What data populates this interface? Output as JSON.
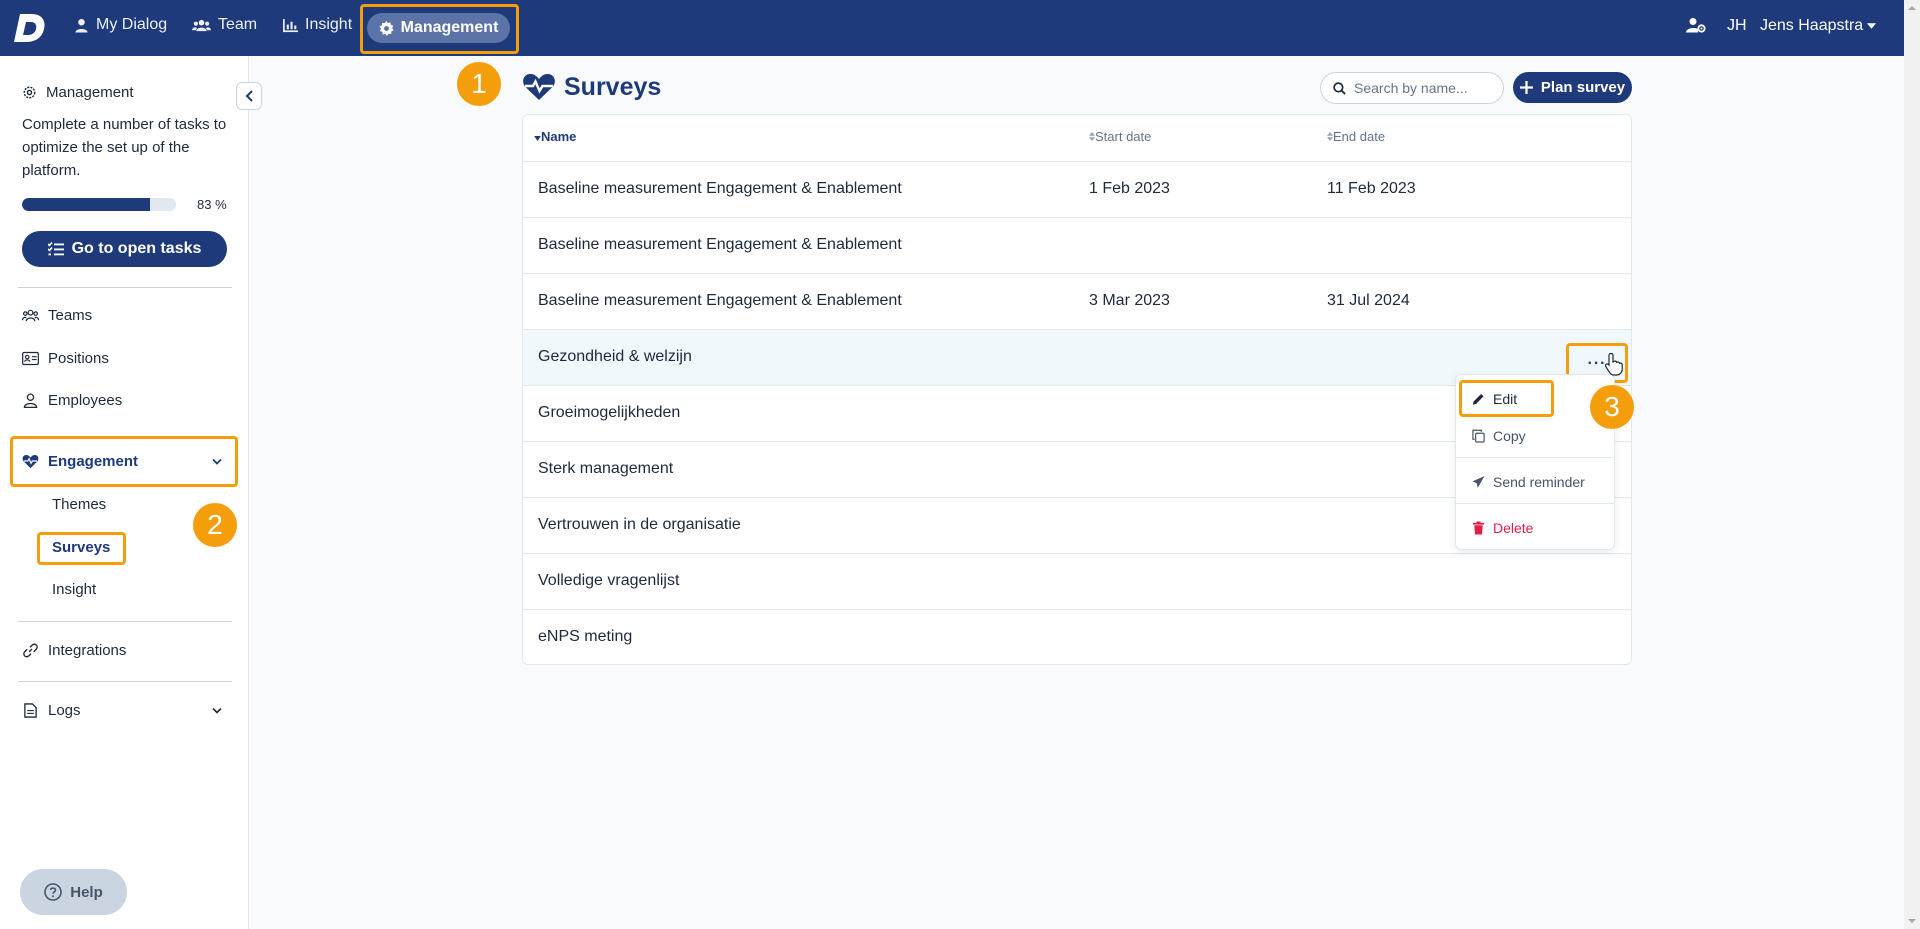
{
  "nav": {
    "items": [
      {
        "label": "My Dialog"
      },
      {
        "label": "Team"
      },
      {
        "label": "Insight"
      }
    ],
    "active_label": "Management",
    "user_initials": "JH",
    "user_name": "Jens Haapstra",
    "logo_letter": "D"
  },
  "annotations": {
    "step1": "1",
    "step2": "2",
    "step3": "3"
  },
  "sidebar": {
    "title": "Management",
    "description": "Complete a number of tasks to optimize the set up of the platform.",
    "progress_percent": 83,
    "progress_label": "83 %",
    "tasks_button": "Go to open tasks",
    "items": {
      "teams": "Teams",
      "positions": "Positions",
      "employees": "Employees",
      "engagement": "Engagement",
      "themes": "Themes",
      "surveys": "Surveys",
      "insight": "Insight",
      "integrations": "Integrations",
      "logs": "Logs"
    },
    "help": "Help"
  },
  "main": {
    "title": "Surveys",
    "search_placeholder": "Search by name...",
    "plan_button": "Plan survey",
    "columns": {
      "name": "Name",
      "start": "Start date",
      "end": "End date"
    },
    "rows": [
      {
        "name": "Baseline measurement Engagement & Enablement",
        "start": "1 Feb 2023",
        "end": "11 Feb 2023"
      },
      {
        "name": "Baseline measurement Engagement & Enablement",
        "start": "",
        "end": ""
      },
      {
        "name": "Baseline measurement Engagement & Enablement",
        "start": "3 Mar 2023",
        "end": "31 Jul 2024"
      },
      {
        "name": "Gezondheid & welzijn",
        "start": "",
        "end": ""
      },
      {
        "name": "Groeimogelijkheden",
        "start": "",
        "end": ""
      },
      {
        "name": "Sterk management",
        "start": "",
        "end": ""
      },
      {
        "name": "Vertrouwen in de organisatie",
        "start": "",
        "end": ""
      },
      {
        "name": "Volledige vragenlijst",
        "start": "",
        "end": ""
      },
      {
        "name": "eNPS meting",
        "start": "",
        "end": ""
      }
    ],
    "row_actions": "···",
    "menu": {
      "edit": "Edit",
      "copy": "Copy",
      "reminder": "Send reminder",
      "delete": "Delete"
    }
  },
  "colors": {
    "brand": "#1e3a7b",
    "highlight": "#f59e0b",
    "danger": "#e11d48"
  }
}
